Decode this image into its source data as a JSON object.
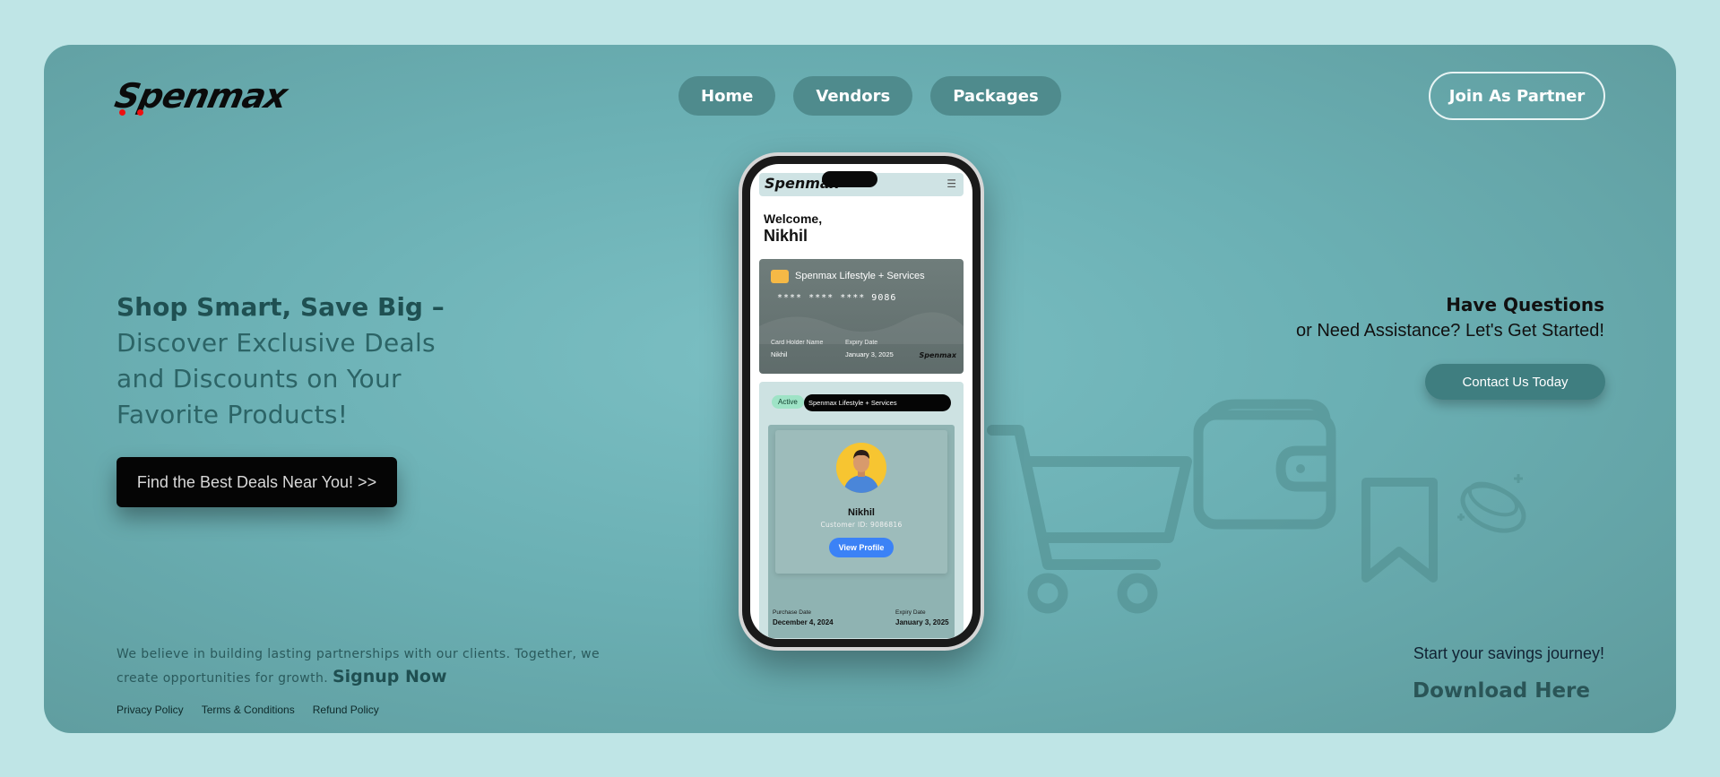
{
  "brand": {
    "logo_text": "Spenmax"
  },
  "nav": {
    "items": [
      "Home",
      "Vendors",
      "Packages"
    ]
  },
  "header": {
    "partner_label": "Join As Partner"
  },
  "hero": {
    "headline_bold": "Shop Smart, Save Big –",
    "headline_lines": [
      "Discover Exclusive Deals",
      "and Discounts on Your",
      "Favorite Products!"
    ],
    "cta_label": "Find the Best Deals Near You! >>"
  },
  "questions": {
    "title": "Have Questions",
    "subtitle": "or Need Assistance? Let's Get Started!",
    "contact_label": "Contact Us Today"
  },
  "footer": {
    "belief_text": "We believe in building lasting partnerships with our clients. Together, we create opportunities for growth.",
    "signup_label": "Signup Now",
    "links": [
      "Privacy Policy",
      "Terms & Conditions",
      "Refund Policy"
    ],
    "journey_text": "Start your savings journey!",
    "download_label": "Download Here"
  },
  "phone": {
    "app_logo": "Spenmax",
    "welcome": "Welcome,",
    "user_name": "Nikhil",
    "card": {
      "brand": "Spenmax Lifestyle + Services",
      "number": "**** **** **** 9086",
      "holder_label": "Card Holder Name",
      "holder_value": "Nikhil",
      "expiry_label": "Expiry Date",
      "expiry_value": "January 3, 2025",
      "mini_logo": "Spenmax"
    },
    "membership": {
      "status": "Active",
      "plan": "Spenmax Lifestyle + Services",
      "name": "Nikhil",
      "customer_id": "Customer ID: 9086816",
      "view_profile": "View Profile",
      "purchase_label": "Purchase Date",
      "purchase_value": "December 4, 2024",
      "expiry_label": "Expiry Date",
      "expiry_value": "January 3, 2025"
    }
  },
  "colors": {
    "panel": "#6bb0b4",
    "page_bg": "#bfe5e6",
    "accent_blue": "#3b82f6",
    "contact": "#3f7e80"
  },
  "icons": [
    "cart-icon",
    "wallet-icon",
    "bookmark-icon",
    "coins-icon",
    "menu-icon"
  ]
}
